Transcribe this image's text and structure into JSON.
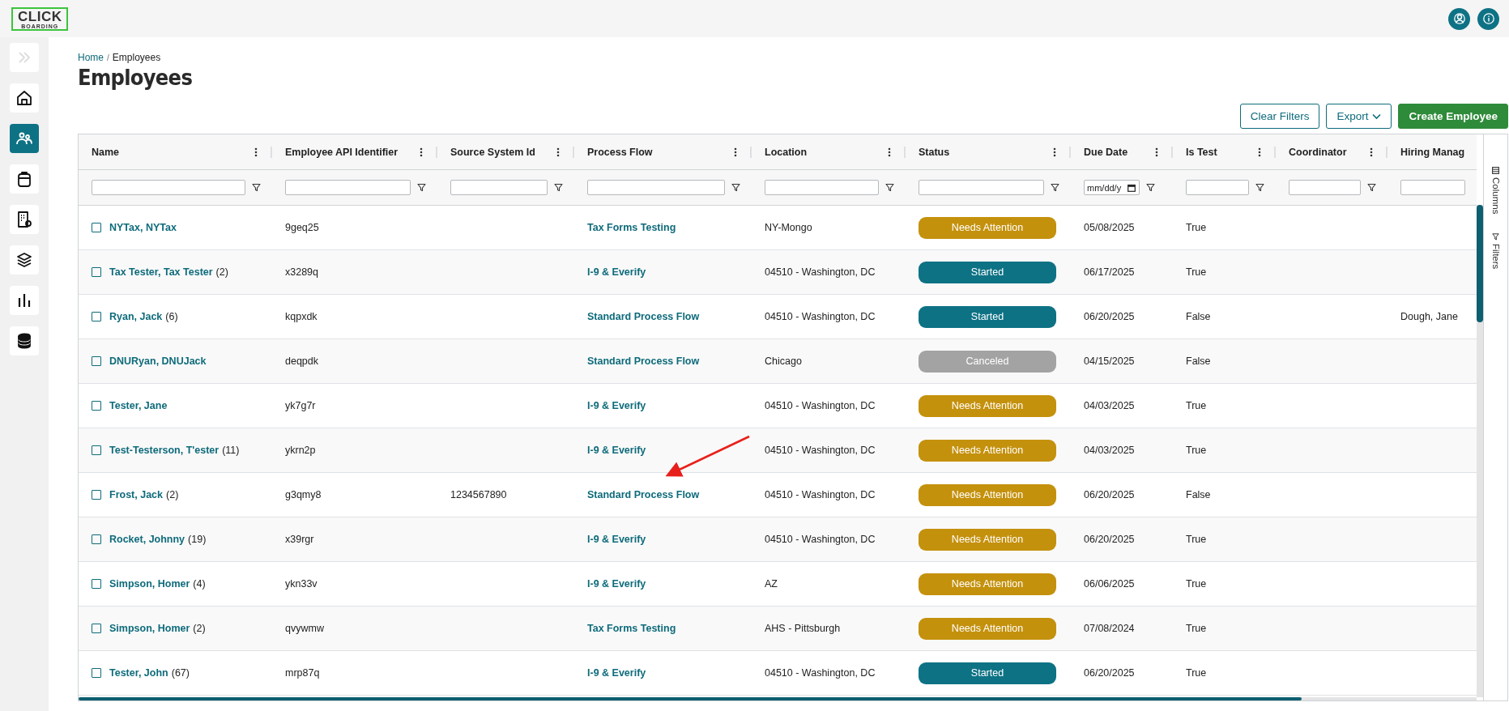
{
  "logo": {
    "title": "CLICK",
    "subtitle": "BOARDING"
  },
  "sidebar": {
    "items": [
      {
        "selected": false
      },
      {
        "selected": false
      },
      {
        "selected": true
      },
      {
        "selected": false
      },
      {
        "selected": false
      },
      {
        "selected": false
      },
      {
        "selected": false
      },
      {
        "selected": false
      }
    ]
  },
  "breadcrumb": {
    "separator": "/",
    "items": [
      {
        "label": "Home",
        "link": true
      },
      {
        "label": "Employees",
        "link": false
      }
    ]
  },
  "title": "Employees",
  "actions": [
    {
      "label": "Clear Filters",
      "kind": "outline"
    },
    {
      "label": "Export",
      "kind": "dropdown"
    },
    {
      "label": "Create Employee",
      "kind": "primary"
    }
  ],
  "table": {
    "columns": [
      {
        "label": "Name",
        "kind": "text"
      },
      {
        "label": "Employee API Identifier",
        "kind": "text"
      },
      {
        "label": "Source System Id",
        "kind": "text"
      },
      {
        "label": "Process Flow",
        "kind": "text"
      },
      {
        "label": "Location",
        "kind": "text"
      },
      {
        "label": "Status",
        "kind": "text"
      },
      {
        "label": "Due Date",
        "kind": "date",
        "placeholder": "mm/dd/y"
      },
      {
        "label": "Is Test",
        "kind": "text"
      },
      {
        "label": "Coordinator",
        "kind": "text"
      },
      {
        "label": "Hiring Manag",
        "kind": "text"
      }
    ],
    "rows": [
      {
        "checked": false,
        "name": "NYTax, NYTax",
        "count": "",
        "api_id": "9geq25",
        "source_id": "",
        "process_flow": "Tax Forms Testing",
        "location": "NY-Mongo",
        "status": {
          "label": "Needs Attention",
          "color": "#c4910d"
        },
        "due_date": "05/08/2025",
        "is_test": "True",
        "coordinator": "",
        "hiring_manager": ""
      },
      {
        "checked": false,
        "name": "Tax Tester, Tax Tester",
        "count": "(2)",
        "api_id": "x3289q",
        "source_id": "",
        "process_flow": "I-9 & Everify",
        "location": "04510 - Washington, DC",
        "status": {
          "label": "Started",
          "color": "#0e7285"
        },
        "due_date": "06/17/2025",
        "is_test": "True",
        "coordinator": "",
        "hiring_manager": ""
      },
      {
        "checked": false,
        "name": "Ryan, Jack",
        "count": "(6)",
        "api_id": "kqpxdk",
        "source_id": "",
        "process_flow": "Standard Process Flow",
        "location": "04510 - Washington, DC",
        "status": {
          "label": "Started",
          "color": "#0e7285"
        },
        "due_date": "06/20/2025",
        "is_test": "False",
        "coordinator": "",
        "hiring_manager": "Dough, Jane"
      },
      {
        "checked": false,
        "name": "DNURyan, DNUJack",
        "count": "",
        "api_id": "deqpdk",
        "source_id": "",
        "process_flow": "Standard Process Flow",
        "location": "Chicago",
        "status": {
          "label": "Canceled",
          "color": "#a3a3a3"
        },
        "due_date": "04/15/2025",
        "is_test": "False",
        "coordinator": "",
        "hiring_manager": ""
      },
      {
        "checked": false,
        "name": "Tester, Jane",
        "count": "",
        "api_id": "yk7g7r",
        "source_id": "",
        "process_flow": "I-9 & Everify",
        "location": "04510 - Washington, DC",
        "status": {
          "label": "Needs Attention",
          "color": "#c4910d"
        },
        "due_date": "04/03/2025",
        "is_test": "True",
        "coordinator": "",
        "hiring_manager": ""
      },
      {
        "checked": false,
        "name": "Test-Testerson, T'ester",
        "count": "(11)",
        "api_id": "ykrn2p",
        "source_id": "",
        "process_flow": "I-9 & Everify",
        "location": "04510 - Washington, DC",
        "status": {
          "label": "Needs Attention",
          "color": "#c4910d"
        },
        "due_date": "04/03/2025",
        "is_test": "True",
        "coordinator": "",
        "hiring_manager": ""
      },
      {
        "checked": false,
        "name": "Frost, Jack",
        "count": "(2)",
        "api_id": "g3qmy8",
        "source_id": "1234567890",
        "process_flow": "Standard Process Flow",
        "location": "04510 - Washington, DC",
        "status": {
          "label": "Needs Attention",
          "color": "#c4910d"
        },
        "due_date": "06/20/2025",
        "is_test": "False",
        "coordinator": "",
        "hiring_manager": ""
      },
      {
        "checked": false,
        "name": "Rocket, Johnny",
        "count": "(19)",
        "api_id": "x39rgr",
        "source_id": "",
        "process_flow": "I-9 & Everify",
        "location": "04510 - Washington, DC",
        "status": {
          "label": "Needs Attention",
          "color": "#c4910d"
        },
        "due_date": "06/20/2025",
        "is_test": "True",
        "coordinator": "",
        "hiring_manager": ""
      },
      {
        "checked": false,
        "name": "Simpson, Homer",
        "count": "(4)",
        "api_id": "ykn33v",
        "source_id": "",
        "process_flow": "I-9 & Everify",
        "location": "AZ",
        "status": {
          "label": "Needs Attention",
          "color": "#c4910d"
        },
        "due_date": "06/06/2025",
        "is_test": "True",
        "coordinator": "",
        "hiring_manager": ""
      },
      {
        "checked": false,
        "name": "Simpson, Homer",
        "count": "(2)",
        "api_id": "qvywmw",
        "source_id": "",
        "process_flow": "Tax Forms Testing",
        "location": "AHS - Pittsburgh",
        "status": {
          "label": "Needs Attention",
          "color": "#c4910d"
        },
        "due_date": "07/08/2024",
        "is_test": "True",
        "coordinator": "",
        "hiring_manager": ""
      },
      {
        "checked": false,
        "name": "Tester, John",
        "count": "(67)",
        "api_id": "mrp87q",
        "source_id": "",
        "process_flow": "I-9 & Everify",
        "location": "04510 - Washington, DC",
        "status": {
          "label": "Started",
          "color": "#0e7285"
        },
        "due_date": "06/20/2025",
        "is_test": "True",
        "coordinator": "",
        "hiring_manager": ""
      }
    ]
  },
  "side_panel": [
    {
      "label": "Columns",
      "kind": "columns"
    },
    {
      "label": "Filters",
      "kind": "filters"
    }
  ]
}
